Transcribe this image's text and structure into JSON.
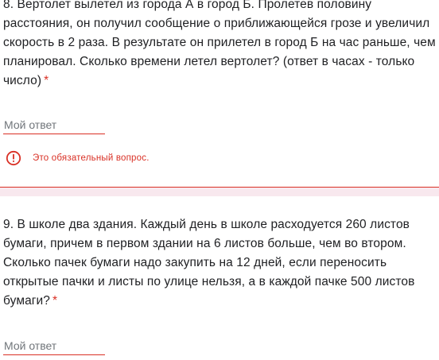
{
  "questions": [
    {
      "text": "8. Вертолет вылетел из города А в город Б. Пролетев половину расстояния, он получил сообщение о приближающейся грозе и увеличил скорость в 2 раза. В результате он прилетел в город Б на час раньше, чем планировал. Сколько времени летел вертолет? (ответ в часах - только число)",
      "required_mark": "*",
      "answer_placeholder": "Мой ответ",
      "answer_value": "",
      "error_icon": "error-circle-icon",
      "error_text": "Это обязательный вопрос."
    },
    {
      "text": "9. В школе два здания. Каждый день в школе расходуется 260 листов бумаги, причем в первом здании на 6 листов больше, чем во втором. Сколько пачек бумаги надо закупить на 12 дней, если переносить открытые пачки и листы по улице нельзя, а в каждой пачке 500 листов бумаги?",
      "required_mark": "*",
      "answer_placeholder": "Мой ответ",
      "answer_value": ""
    }
  ],
  "colors": {
    "error": "#d93025",
    "text": "#202124",
    "placeholder": "#70757a",
    "divider_band": "#f8e8ee"
  }
}
